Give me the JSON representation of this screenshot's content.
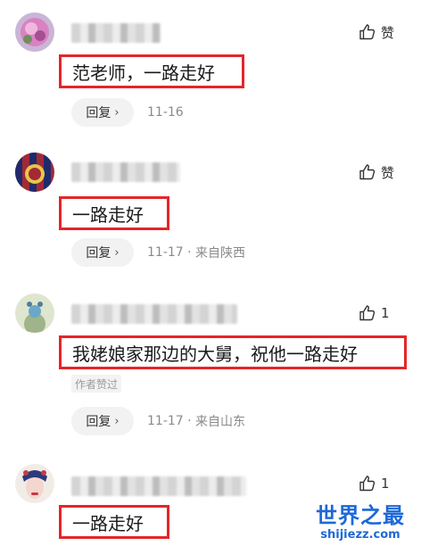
{
  "comments": [
    {
      "content": "范老师，一路走好",
      "reply_label": "回复",
      "date": "11-16",
      "location": "",
      "like_label": "赞",
      "author_badge": ""
    },
    {
      "content": "一路走好",
      "reply_label": "回复",
      "date": "11-17",
      "location": "来自陕西",
      "like_label": "赞",
      "author_badge": ""
    },
    {
      "content": "我姥娘家那边的大舅，祝他一路走好",
      "reply_label": "回复",
      "date": "11-17",
      "location": "来自山东",
      "like_label": "1",
      "author_badge": "作者赞过"
    },
    {
      "content": "一路走好",
      "reply_label": "",
      "date": "",
      "location": "",
      "like_label": "1",
      "author_badge": ""
    }
  ],
  "separator": " · ",
  "reply_chevron": "›",
  "watermark": {
    "title": "世界之最",
    "url": "shijiezz.com"
  },
  "colors": {
    "highlight_box": "#e5252a",
    "watermark": "#1e68d8",
    "meta_text": "#8a8a8a",
    "reply_bg": "#f2f2f2"
  },
  "icons": [
    "thumbs-up-icon",
    "chevron-right-icon"
  ]
}
